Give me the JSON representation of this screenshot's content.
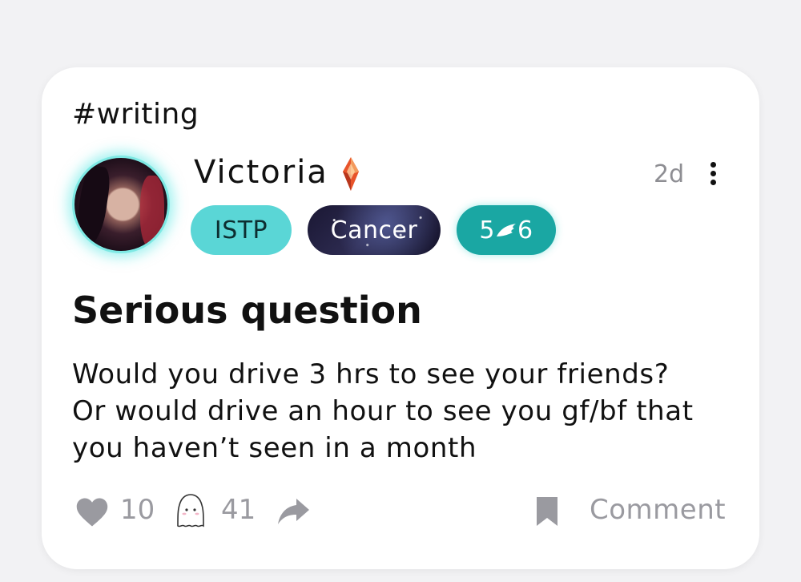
{
  "post": {
    "topic": "#writing",
    "author": {
      "name": "Victoria",
      "badge_icon": "gem-icon"
    },
    "time_ago": "2d",
    "tags": {
      "mbti": "ISTP",
      "zodiac": "Cancer",
      "enneagram_core": "5",
      "enneagram_wing": "6"
    },
    "title": "Serious question",
    "body_lines": [
      "Would you drive 3 hrs to see your friends?",
      "Or would drive an hour to see you gf/bf that",
      "you haven’t seen in a month"
    ],
    "likes": "10",
    "comments": "41",
    "comment_label": "Comment"
  },
  "colors": {
    "accent_teal": "#5ad6d6",
    "enneagram_teal": "#1aa7a3",
    "muted_text": "#9a9aa0"
  }
}
